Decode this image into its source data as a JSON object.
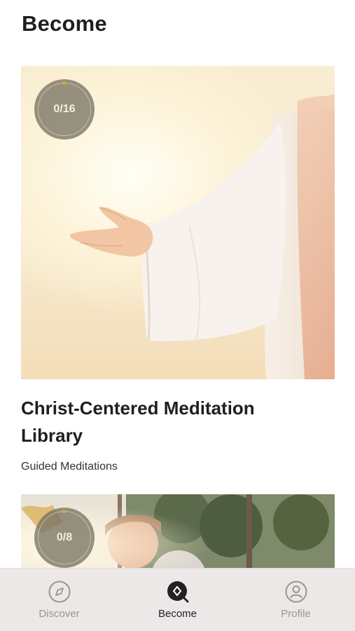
{
  "header": {
    "title": "Become"
  },
  "cards": [
    {
      "progress": "0/16",
      "title": "Christ-Centered Meditation Library",
      "subtitle": "Guided Meditations"
    },
    {
      "progress": "0/8"
    }
  ],
  "nav": {
    "items": [
      {
        "label": "Discover",
        "icon": "compass-icon",
        "active": false
      },
      {
        "label": "Become",
        "icon": "become-search-icon",
        "active": true
      },
      {
        "label": "Profile",
        "icon": "profile-icon",
        "active": false
      }
    ]
  },
  "colors": {
    "accent_dot": "#e8a23a",
    "nav_background": "#ece8e8",
    "active_label": "#222222",
    "inactive_label": "#9a9696"
  }
}
